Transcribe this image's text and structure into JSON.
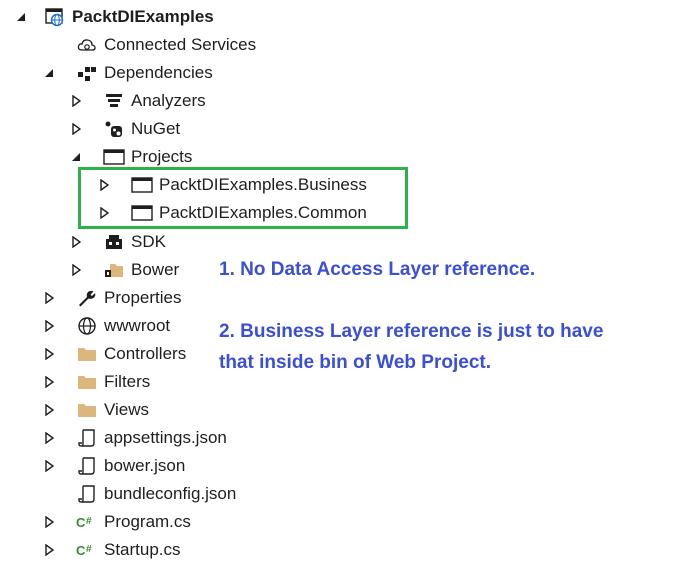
{
  "tree": {
    "root": "PacktDIExamples",
    "connected_services": "Connected Services",
    "dependencies": "Dependencies",
    "analyzers": "Analyzers",
    "nuget": "NuGet",
    "projects": "Projects",
    "project_business": "PacktDIExamples.Business",
    "project_common": "PacktDIExamples.Common",
    "sdk": "SDK",
    "bower_dep": "Bower",
    "properties": "Properties",
    "wwwroot": "wwwroot",
    "controllers": "Controllers",
    "filters": "Filters",
    "views": "Views",
    "appsettings": "appsettings.json",
    "bower_json": "bower.json",
    "bundleconfig": "bundleconfig.json",
    "program": "Program.cs",
    "startup": "Startup.cs"
  },
  "notes": {
    "note1": "1. No Data Access Layer reference.",
    "note2_line1": "2. Business Layer reference is just to have",
    "note2_line2": "that inside bin of Web Project."
  },
  "colors": {
    "highlight_border": "#2eb04a",
    "note_text": "#3b4fd6",
    "folder": "#dcb67a"
  }
}
